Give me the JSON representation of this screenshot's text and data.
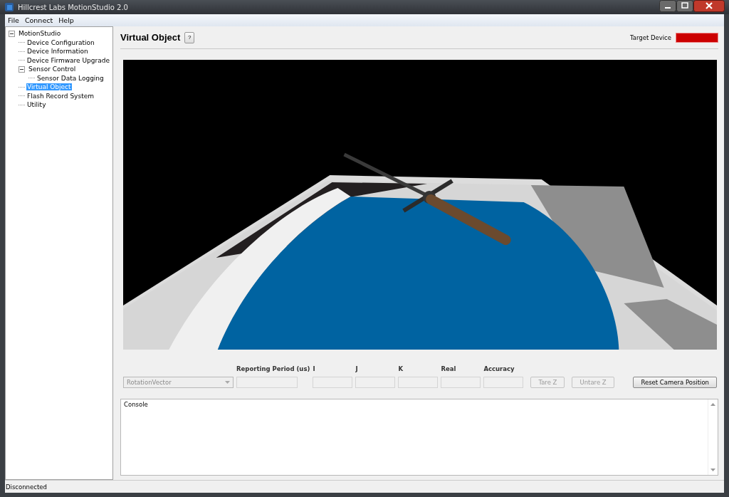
{
  "window": {
    "title": "Hillcrest Labs MotionStudio 2.0"
  },
  "menu": [
    "File",
    "Connect",
    "Help"
  ],
  "tree": [
    {
      "label": "MotionStudio",
      "expanded": true,
      "selected": false,
      "children": [
        {
          "label": "Device Configuration",
          "selected": false
        },
        {
          "label": "Device Information",
          "selected": false
        },
        {
          "label": "Device Firmware Upgrade",
          "selected": false
        },
        {
          "label": "Sensor Control",
          "expanded": true,
          "selected": false,
          "children": [
            {
              "label": "Sensor Data Logging",
              "selected": false
            }
          ]
        },
        {
          "label": "Virtual Object",
          "selected": true
        },
        {
          "label": "Flash Record System",
          "selected": false
        },
        {
          "label": "Utility",
          "selected": false
        }
      ]
    }
  ],
  "page": {
    "title": "Virtual Object",
    "help": "?",
    "target_label": "Target Device"
  },
  "controls": {
    "dropdown": {
      "value": "RotationVector",
      "disabled": true
    },
    "fields": [
      {
        "label": "Reporting Period (us)"
      },
      {
        "label": "I"
      },
      {
        "label": "J"
      },
      {
        "label": "K"
      },
      {
        "label": "Real"
      },
      {
        "label": "Accuracy"
      }
    ],
    "buttons": [
      {
        "label": "Tare Z",
        "disabled": true
      },
      {
        "label": "Untare Z",
        "disabled": true
      },
      {
        "label": "Reset Camera Position",
        "disabled": false
      }
    ]
  },
  "console": {
    "label": "Console"
  },
  "status_bar": "Disconnected"
}
